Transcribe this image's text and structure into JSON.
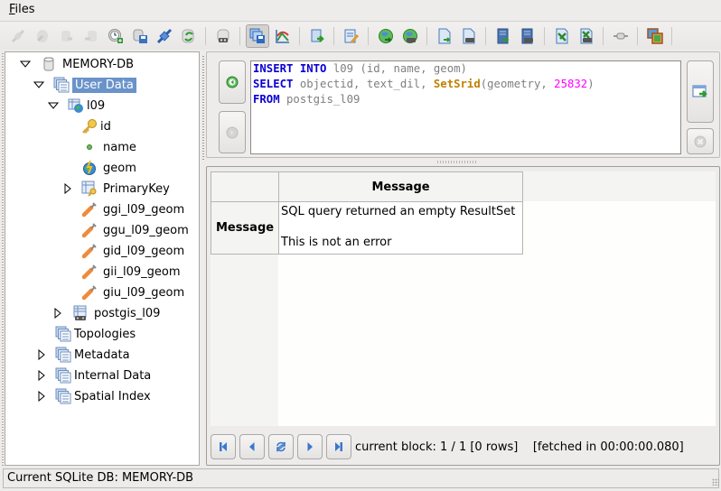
{
  "menu": {
    "files": "Files",
    "files_mnemonic": "F",
    "files_rest": "iles"
  },
  "toolbar": {
    "buttons": [
      {
        "icon": "connect-icon",
        "enabled": false
      },
      {
        "icon": "disconnect-icon",
        "enabled": false
      },
      {
        "icon": "db-export-icon",
        "enabled": false
      },
      {
        "icon": "db-import-icon",
        "enabled": false
      },
      {
        "icon": "memory-db-new-icon",
        "enabled": true
      },
      {
        "icon": "save-db-icon",
        "enabled": true
      },
      {
        "icon": "attach-icon",
        "enabled": true
      },
      {
        "icon": "refresh-db-icon",
        "enabled": true
      },
      {
        "icon": "virtual-db-icon",
        "enabled": true
      },
      {
        "icon": "sql-log-icon",
        "enabled": true,
        "active": true
      },
      {
        "icon": "chart-icon",
        "enabled": true
      },
      {
        "icon": "load-sql-icon",
        "enabled": true
      },
      {
        "icon": "edit-script-icon",
        "enabled": true
      },
      {
        "icon": "load-shp-icon",
        "enabled": true
      },
      {
        "icon": "virtual-shp-icon",
        "enabled": true
      },
      {
        "icon": "load-txt-icon",
        "enabled": true
      },
      {
        "icon": "virtual-txt-icon",
        "enabled": true
      },
      {
        "icon": "load-dbf-icon",
        "enabled": true
      },
      {
        "icon": "virtual-dbf-icon",
        "enabled": true
      },
      {
        "icon": "load-xl-icon",
        "enabled": true
      },
      {
        "icon": "virtual-xl-icon",
        "enabled": true
      },
      {
        "icon": "network-icon",
        "enabled": true
      },
      {
        "icon": "raster-icon",
        "enabled": true
      }
    ]
  },
  "tree": {
    "root": "MEMORY-DB",
    "user_data": "User Data",
    "table": "l09",
    "columns": [
      "id",
      "name",
      "geom"
    ],
    "primary_key": "PrimaryKey",
    "indices": [
      "ggi_l09_geom",
      "ggu_l09_geom",
      "gid_l09_geom",
      "gii_l09_geom",
      "giu_l09_geom"
    ],
    "virtual_table": "postgis_l09",
    "topologies": "Topologies",
    "metadata": "Metadata",
    "internal_data": "Internal Data",
    "spatial_index": "Spatial Index"
  },
  "query": {
    "line1": {
      "kw1": "INSERT",
      "kw2": "INTO",
      "rest": " l09 (id, name, geom)"
    },
    "line2": {
      "kw": "SELECT",
      "mid": " objectid, text_dil, ",
      "fn": "SetSrid",
      "args": "(geometry, ",
      "num": "25832",
      "close": ")"
    },
    "line3": {
      "kw": "FROM",
      "rest": " postgis_l09"
    }
  },
  "results": {
    "column_header": "Message",
    "row_header": "Message",
    "message_line1": "SQL query returned an empty ResultSet",
    "message_line2": "This is not an error"
  },
  "navigation": {
    "info": "current block: 1 / 1 [0 rows]    [fetched in 00:00:00.080]"
  },
  "status": {
    "text": "Current SQLite DB: MEMORY-DB"
  }
}
